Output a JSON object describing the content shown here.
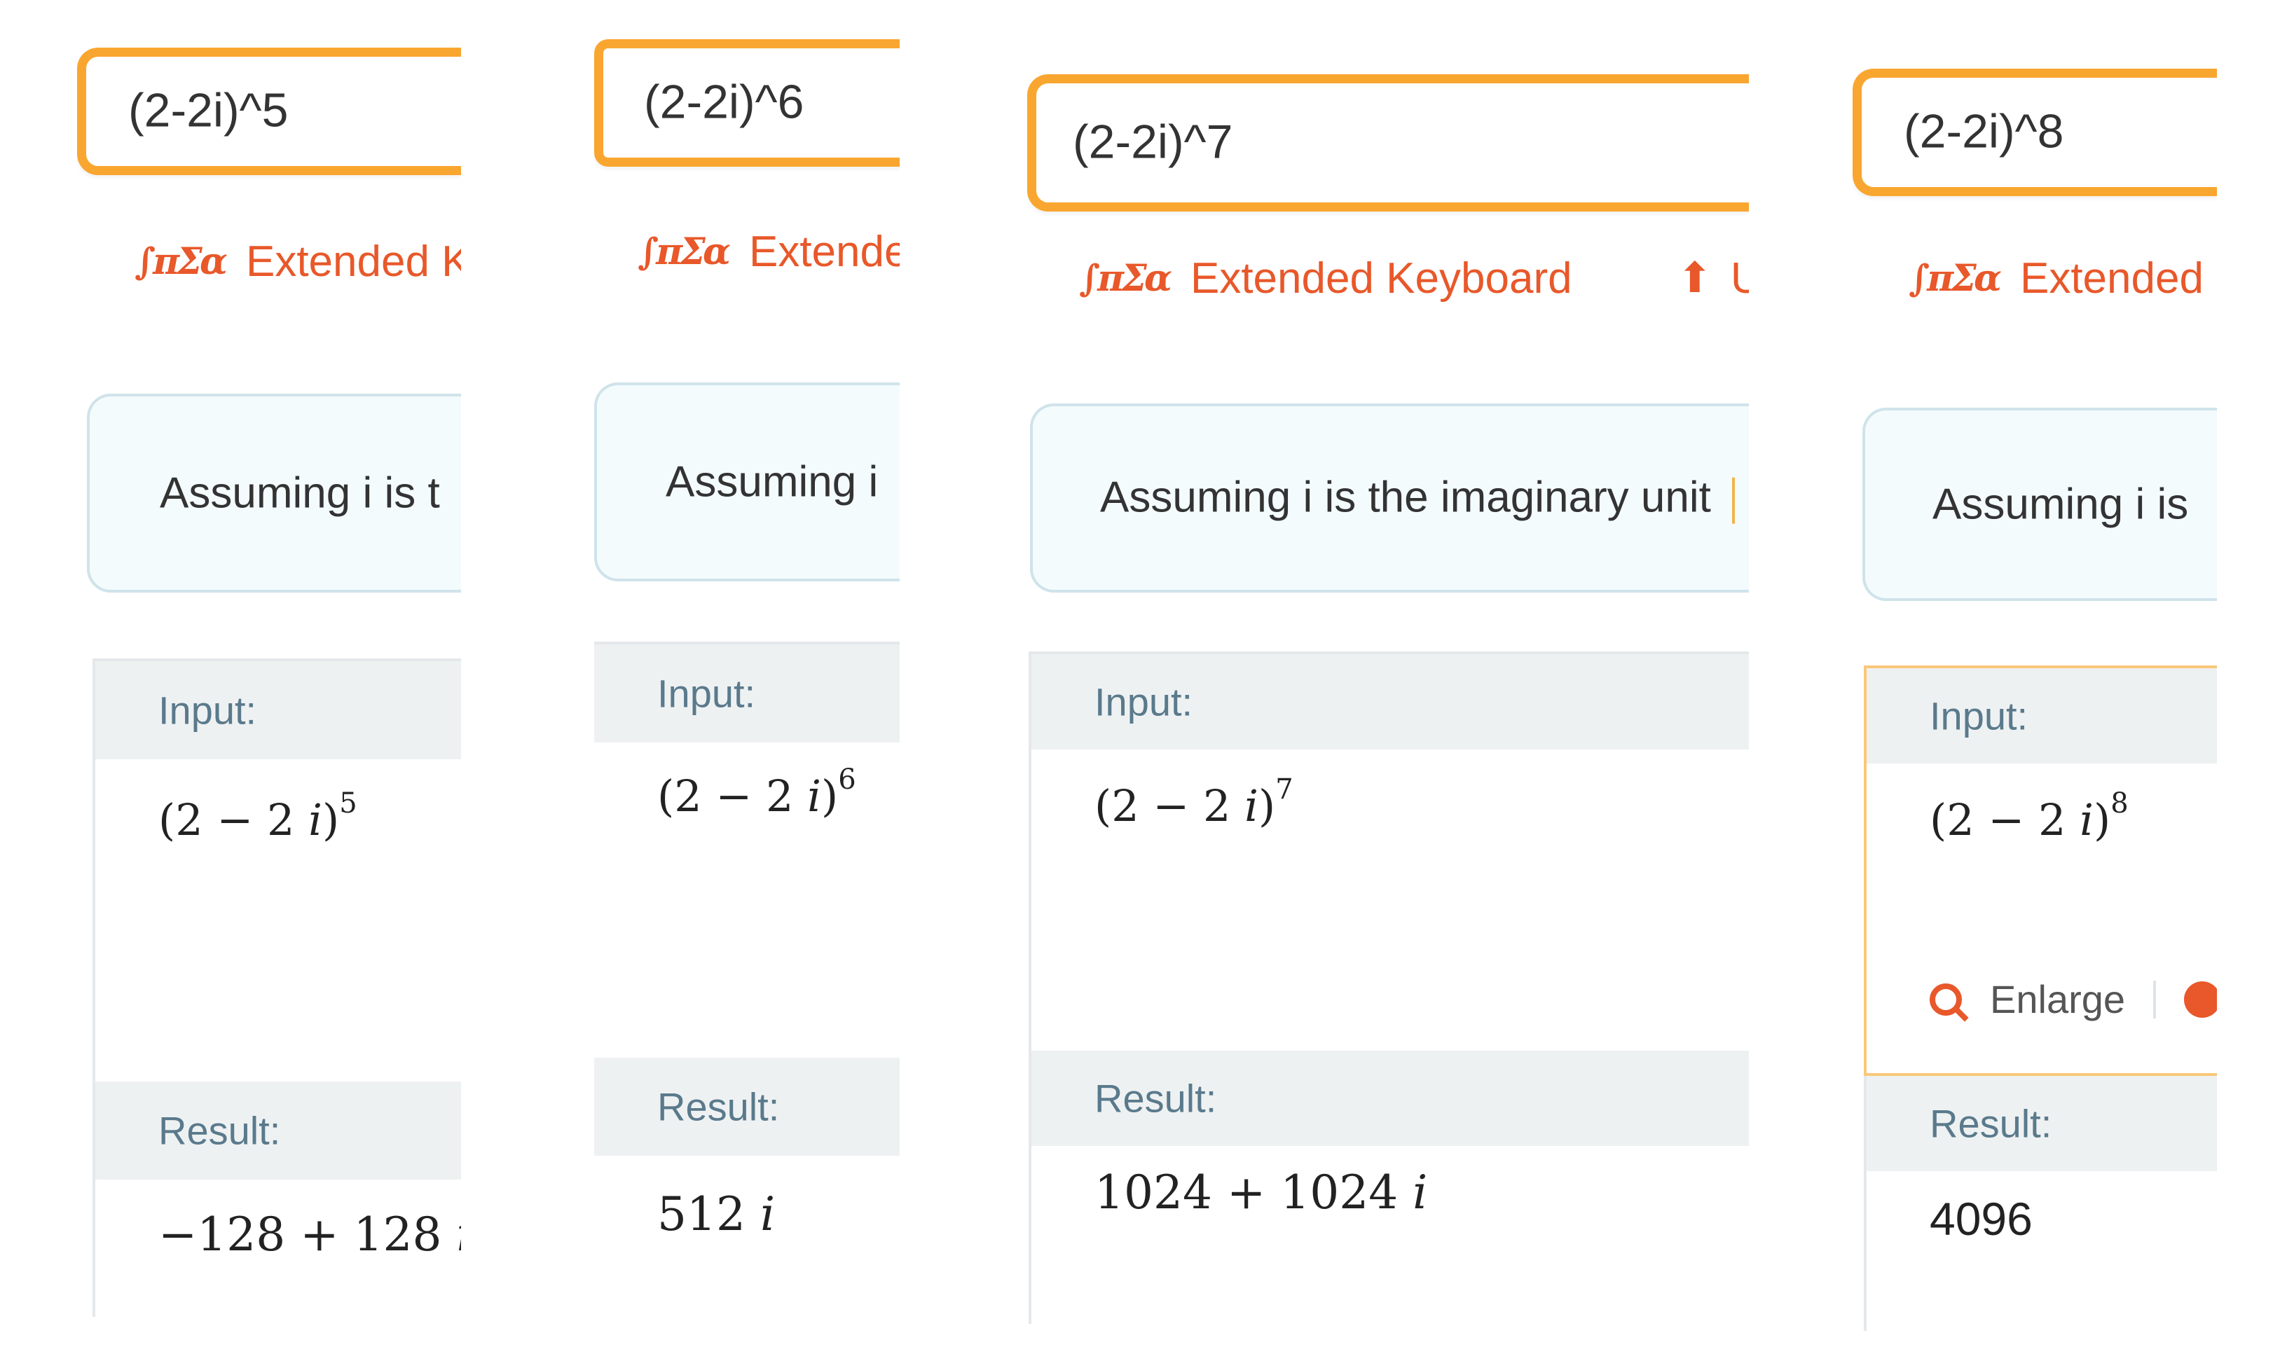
{
  "panels": [
    {
      "query": "(2-2i)^5",
      "keyboard_label": "Extended Ke",
      "assumption": "Assuming i is t",
      "input_heading": "Input:",
      "input_expr_base": "(2 − 2 ",
      "input_expr_i": "i",
      "input_expr_close": ")",
      "input_exponent": "5",
      "result_heading": "Result:",
      "result_value": "−128 + 128 ",
      "result_i": "i"
    },
    {
      "query": "(2-2i)^6",
      "keyboard_label": "Extendec",
      "assumption": "Assuming i",
      "input_heading": "Input:",
      "input_expr_base": "(2 − 2 ",
      "input_expr_i": "i",
      "input_expr_close": ")",
      "input_exponent": "6",
      "result_heading": "Result:",
      "result_value": "512 ",
      "result_i": "i"
    },
    {
      "query": "(2-2i)^7",
      "keyboard_label": "Extended Keyboard",
      "upload_label": "U",
      "assumption": "Assuming i is the imaginary unit",
      "input_heading": "Input:",
      "input_expr_base": "(2 − 2 ",
      "input_expr_i": "i",
      "input_expr_close": ")",
      "input_exponent": "7",
      "result_heading": "Result:",
      "result_value": "1024 + 1024 ",
      "result_i": "i"
    },
    {
      "query": "(2-2i)^8",
      "keyboard_label": "Extended K",
      "assumption": "Assuming i is",
      "input_heading": "Input:",
      "input_expr_base": "(2 − 2 ",
      "input_expr_i": "i",
      "input_expr_close": ")",
      "input_exponent": "8",
      "enlarge_label": "Enlarge",
      "result_heading": "Result:",
      "result_value": "4096",
      "result_i": ""
    }
  ],
  "icons": {
    "keyboard": "∫πΣɑ",
    "upload": "⬆"
  },
  "colors": {
    "accent_orange": "#e8582a",
    "input_border": "#f9a630",
    "assumption_bg": "#f4fbfd",
    "pod_header_bg": "#eef1f2",
    "pod_label": "#5a7a8c"
  }
}
